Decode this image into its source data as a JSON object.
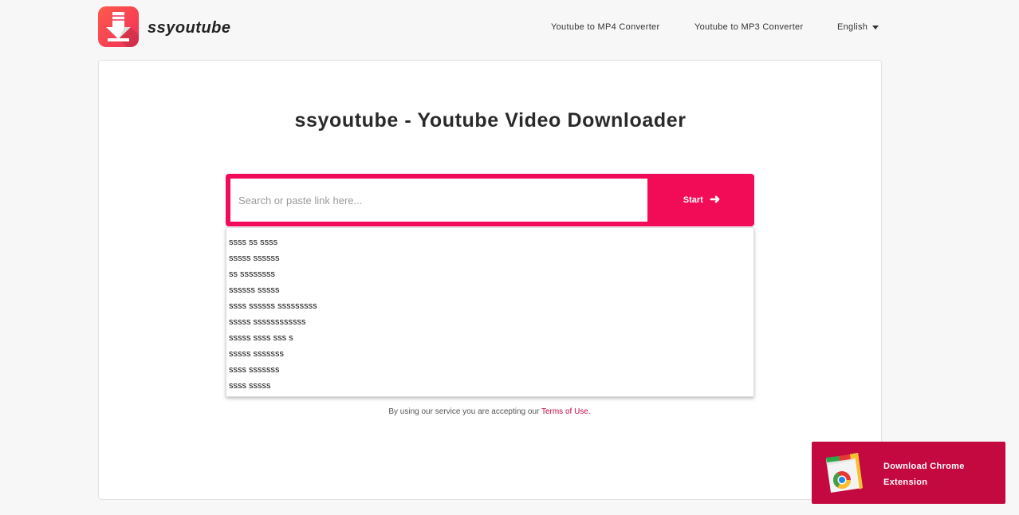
{
  "header": {
    "brand": "ssyoutube",
    "nav": {
      "item1": "Youtube to MP4 Converter",
      "item2": "Youtube to MP3 Converter",
      "item3": "English"
    }
  },
  "main": {
    "title": "ssyoutube - Youtube Video Downloader",
    "search": {
      "placeholder": "Search or paste link here...",
      "button_label": "Start"
    },
    "suggestions": [
      "ssss ss ssss",
      "sssss ssssss",
      "ss ssssssss",
      "ssssss sssss",
      "ssss ssssss sssssssss",
      "sssss ssssssssssss",
      "sssss ssss sss s",
      "sssss sssssss",
      "ssss sssssss",
      "ssss sssss"
    ],
    "terms": {
      "prefix": "By using our service you are accepting our ",
      "link": "Terms of Use."
    }
  },
  "extension_banner": {
    "line1": "Download Chrome",
    "line2": "Extension"
  },
  "colors": {
    "accent": "#f20c58",
    "banner": "#c3093f",
    "logo_gradient_start": "#ff5a4a",
    "logo_gradient_end": "#f0305a"
  },
  "icons": {
    "logo": "download-arrow-icon",
    "start": "arrow-right-icon",
    "nav_caret": "caret-down-icon",
    "extension": "chrome-store-icon"
  }
}
